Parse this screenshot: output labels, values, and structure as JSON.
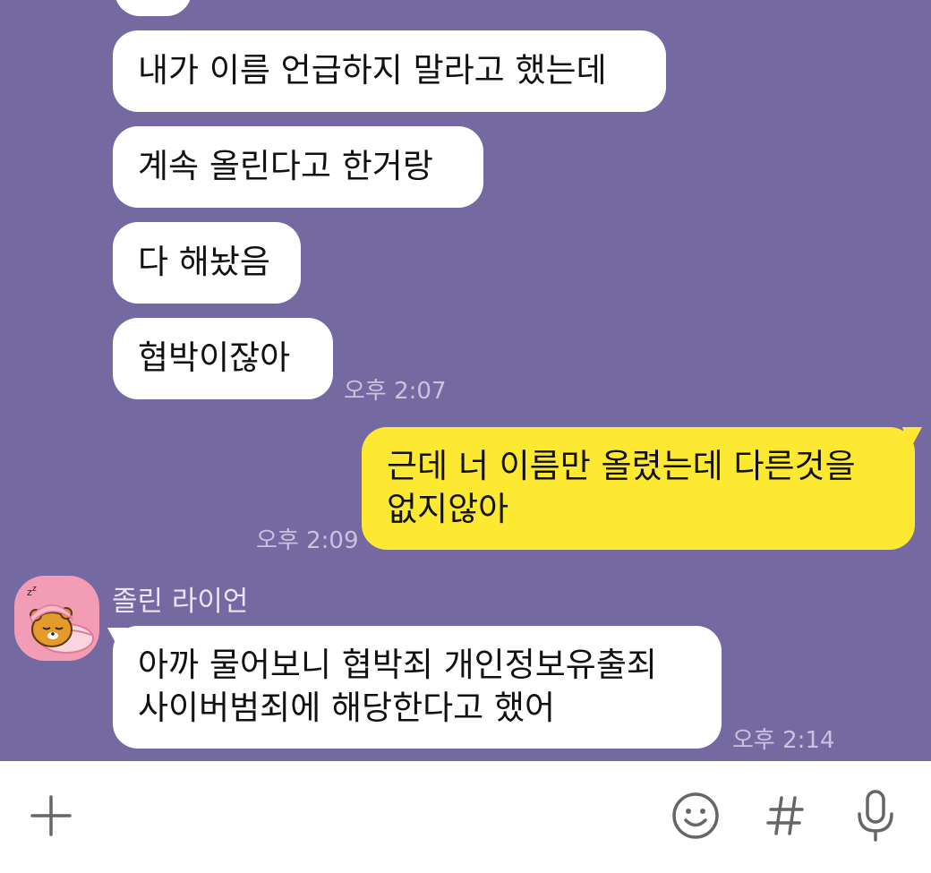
{
  "messages": [
    {
      "text": "내가 이름 언급하지 말라고 했는데"
    },
    {
      "text": "계속 올린다고 한거랑"
    },
    {
      "text": "다 해놨음"
    },
    {
      "text": "협박이잖아",
      "time": "오후 2:07"
    }
  ],
  "my_message": {
    "line1": "근데 너 이름만 올렸는데 다른것을",
    "line2": "없지않아",
    "time": "오후 2:09"
  },
  "other": {
    "sender": "졸린 라이언",
    "line1": "아까 물어보니 협박죄 개인정보유출죄",
    "line2": "사이버범죄에 해당한다고 했어",
    "time": "오후 2:14"
  },
  "colors": {
    "background": "#7469a0",
    "my_bubble": "#fde932",
    "their_bubble": "#ffffff",
    "avatar_bg": "#f39cb6"
  },
  "input_bar": {
    "icons": [
      "plus-icon",
      "emoji-icon",
      "hashtag-icon",
      "microphone-icon"
    ]
  }
}
